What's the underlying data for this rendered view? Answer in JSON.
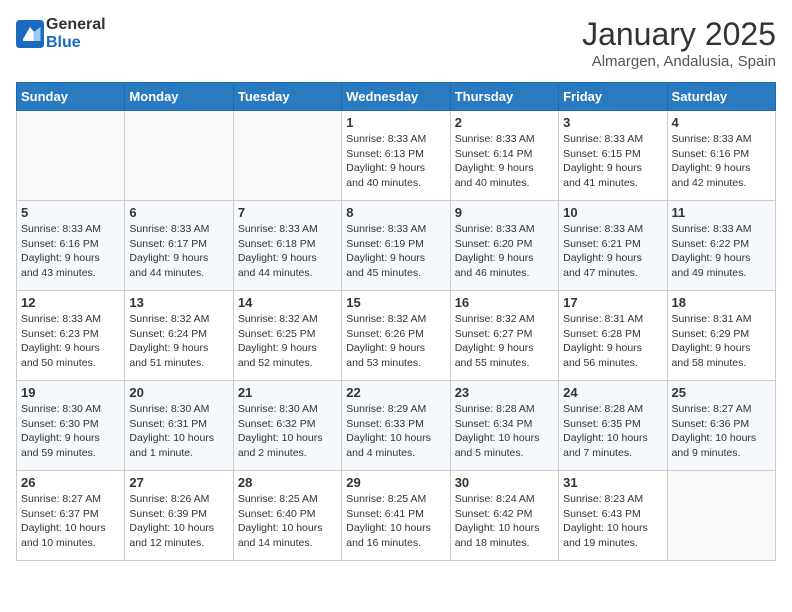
{
  "header": {
    "logo_line1": "General",
    "logo_line2": "Blue",
    "month_title": "January 2025",
    "location": "Almargen, Andalusia, Spain"
  },
  "days_of_week": [
    "Sunday",
    "Monday",
    "Tuesday",
    "Wednesday",
    "Thursday",
    "Friday",
    "Saturday"
  ],
  "weeks": [
    [
      {
        "day": "",
        "info": ""
      },
      {
        "day": "",
        "info": ""
      },
      {
        "day": "",
        "info": ""
      },
      {
        "day": "1",
        "info": "Sunrise: 8:33 AM\nSunset: 6:13 PM\nDaylight: 9 hours\nand 40 minutes."
      },
      {
        "day": "2",
        "info": "Sunrise: 8:33 AM\nSunset: 6:14 PM\nDaylight: 9 hours\nand 40 minutes."
      },
      {
        "day": "3",
        "info": "Sunrise: 8:33 AM\nSunset: 6:15 PM\nDaylight: 9 hours\nand 41 minutes."
      },
      {
        "day": "4",
        "info": "Sunrise: 8:33 AM\nSunset: 6:16 PM\nDaylight: 9 hours\nand 42 minutes."
      }
    ],
    [
      {
        "day": "5",
        "info": "Sunrise: 8:33 AM\nSunset: 6:16 PM\nDaylight: 9 hours\nand 43 minutes."
      },
      {
        "day": "6",
        "info": "Sunrise: 8:33 AM\nSunset: 6:17 PM\nDaylight: 9 hours\nand 44 minutes."
      },
      {
        "day": "7",
        "info": "Sunrise: 8:33 AM\nSunset: 6:18 PM\nDaylight: 9 hours\nand 44 minutes."
      },
      {
        "day": "8",
        "info": "Sunrise: 8:33 AM\nSunset: 6:19 PM\nDaylight: 9 hours\nand 45 minutes."
      },
      {
        "day": "9",
        "info": "Sunrise: 8:33 AM\nSunset: 6:20 PM\nDaylight: 9 hours\nand 46 minutes."
      },
      {
        "day": "10",
        "info": "Sunrise: 8:33 AM\nSunset: 6:21 PM\nDaylight: 9 hours\nand 47 minutes."
      },
      {
        "day": "11",
        "info": "Sunrise: 8:33 AM\nSunset: 6:22 PM\nDaylight: 9 hours\nand 49 minutes."
      }
    ],
    [
      {
        "day": "12",
        "info": "Sunrise: 8:33 AM\nSunset: 6:23 PM\nDaylight: 9 hours\nand 50 minutes."
      },
      {
        "day": "13",
        "info": "Sunrise: 8:32 AM\nSunset: 6:24 PM\nDaylight: 9 hours\nand 51 minutes."
      },
      {
        "day": "14",
        "info": "Sunrise: 8:32 AM\nSunset: 6:25 PM\nDaylight: 9 hours\nand 52 minutes."
      },
      {
        "day": "15",
        "info": "Sunrise: 8:32 AM\nSunset: 6:26 PM\nDaylight: 9 hours\nand 53 minutes."
      },
      {
        "day": "16",
        "info": "Sunrise: 8:32 AM\nSunset: 6:27 PM\nDaylight: 9 hours\nand 55 minutes."
      },
      {
        "day": "17",
        "info": "Sunrise: 8:31 AM\nSunset: 6:28 PM\nDaylight: 9 hours\nand 56 minutes."
      },
      {
        "day": "18",
        "info": "Sunrise: 8:31 AM\nSunset: 6:29 PM\nDaylight: 9 hours\nand 58 minutes."
      }
    ],
    [
      {
        "day": "19",
        "info": "Sunrise: 8:30 AM\nSunset: 6:30 PM\nDaylight: 9 hours\nand 59 minutes."
      },
      {
        "day": "20",
        "info": "Sunrise: 8:30 AM\nSunset: 6:31 PM\nDaylight: 10 hours\nand 1 minute."
      },
      {
        "day": "21",
        "info": "Sunrise: 8:30 AM\nSunset: 6:32 PM\nDaylight: 10 hours\nand 2 minutes."
      },
      {
        "day": "22",
        "info": "Sunrise: 8:29 AM\nSunset: 6:33 PM\nDaylight: 10 hours\nand 4 minutes."
      },
      {
        "day": "23",
        "info": "Sunrise: 8:28 AM\nSunset: 6:34 PM\nDaylight: 10 hours\nand 5 minutes."
      },
      {
        "day": "24",
        "info": "Sunrise: 8:28 AM\nSunset: 6:35 PM\nDaylight: 10 hours\nand 7 minutes."
      },
      {
        "day": "25",
        "info": "Sunrise: 8:27 AM\nSunset: 6:36 PM\nDaylight: 10 hours\nand 9 minutes."
      }
    ],
    [
      {
        "day": "26",
        "info": "Sunrise: 8:27 AM\nSunset: 6:37 PM\nDaylight: 10 hours\nand 10 minutes."
      },
      {
        "day": "27",
        "info": "Sunrise: 8:26 AM\nSunset: 6:39 PM\nDaylight: 10 hours\nand 12 minutes."
      },
      {
        "day": "28",
        "info": "Sunrise: 8:25 AM\nSunset: 6:40 PM\nDaylight: 10 hours\nand 14 minutes."
      },
      {
        "day": "29",
        "info": "Sunrise: 8:25 AM\nSunset: 6:41 PM\nDaylight: 10 hours\nand 16 minutes."
      },
      {
        "day": "30",
        "info": "Sunrise: 8:24 AM\nSunset: 6:42 PM\nDaylight: 10 hours\nand 18 minutes."
      },
      {
        "day": "31",
        "info": "Sunrise: 8:23 AM\nSunset: 6:43 PM\nDaylight: 10 hours\nand 19 minutes."
      },
      {
        "day": "",
        "info": ""
      }
    ]
  ]
}
